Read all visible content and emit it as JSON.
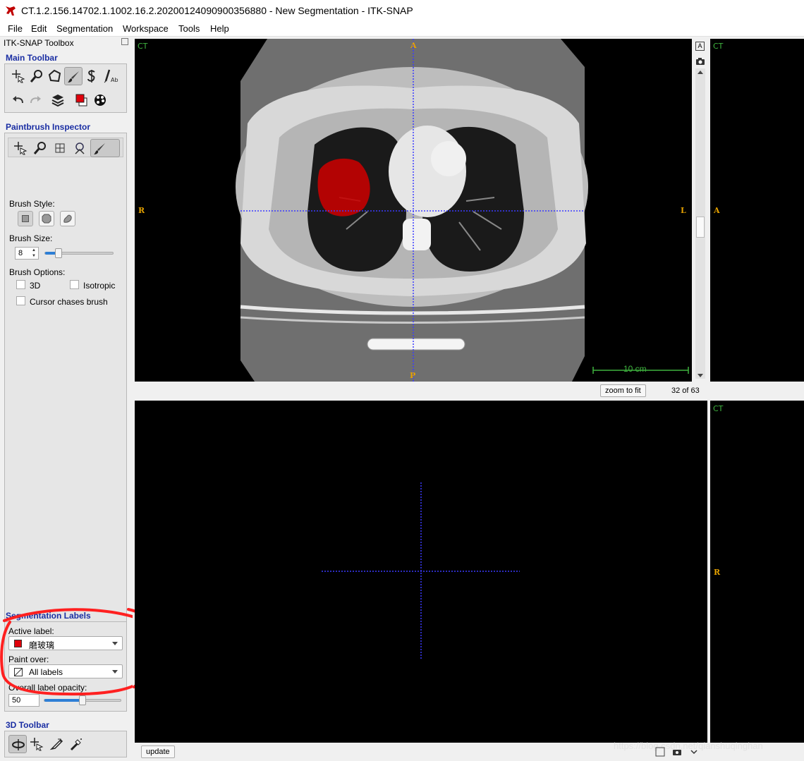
{
  "window": {
    "title": "CT.1.2.156.14702.1.1002.16.2.20200124090900356880 - New Segmentation - ITK-SNAP",
    "logo": "itksnap-logo-icon"
  },
  "menu": [
    "File",
    "Edit",
    "Segmentation",
    "Workspace",
    "Tools",
    "Help"
  ],
  "toolbox": {
    "title": "ITK-SNAP Toolbox",
    "main_toolbar": {
      "title": "Main Toolbar",
      "tools": [
        "crosshair-icon",
        "zoom-icon",
        "polygon-icon",
        "paintbrush-icon",
        "snake-icon",
        "annotation-icon"
      ],
      "actions": [
        "undo-icon",
        "redo-icon",
        "layers-icon",
        "label-color-icon",
        "palette-icon"
      ],
      "active_tool": "paintbrush-icon"
    },
    "paintbrush_inspector": {
      "title": "Paintbrush Inspector",
      "brush_style_label": "Brush Style:",
      "brush_size_label": "Brush Size:",
      "brush_size_value": "8",
      "brush_size_fraction": 0.2,
      "brush_options_label": "Brush Options:",
      "option_3d": "3D",
      "option_isotropic": "Isotropic",
      "option_cursor_chases": "Cursor chases brush"
    },
    "segmentation_labels": {
      "title": "Segmentation Labels",
      "active_label_caption": "Active label:",
      "active_label_value": "磨玻璃",
      "active_label_color": "#e0000b",
      "paint_over_caption": "Paint over:",
      "paint_over_value": "All labels",
      "opacity_caption": "Overall label opacity:",
      "opacity_value": "50",
      "opacity_fraction": 0.5
    },
    "toolbar_3d": {
      "title": "3D Toolbar",
      "tools": [
        "rotate-icon",
        "crosshair-icon",
        "scalpel-icon",
        "spray-icon"
      ]
    }
  },
  "views": {
    "axial": {
      "layer": "CT",
      "orient_top": "A",
      "orient_bottom": "P",
      "orient_left": "R",
      "orient_right": "L",
      "scale_text": "10 cm",
      "zoom_button": "zoom to fit",
      "slice_text": "32 of 63"
    },
    "right_top": {
      "layer": "CT",
      "orient_left": "A"
    },
    "bottom": {
      "update_button": "update"
    },
    "right_bottom": {
      "layer": "CT",
      "orient_left": "R"
    }
  },
  "watermark": "https://blog.csdn.net/qianshuqinghan",
  "colors": {
    "section_title": "#1a2ea3",
    "crosshair": "#3b3bff",
    "layer_label": "#3fb33f",
    "orientation_label": "#e6a200",
    "annotation_circle": "#ff2020",
    "segmentation": "#c80000"
  }
}
